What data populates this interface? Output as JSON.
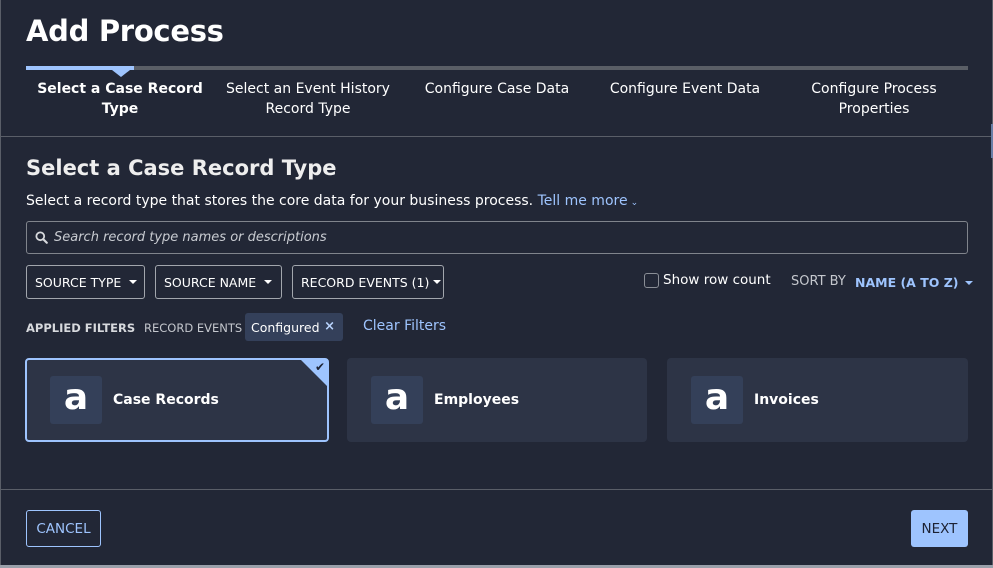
{
  "dialog": {
    "title": "Add Process"
  },
  "stepper": {
    "steps": [
      {
        "label": "Select a Case Record Type",
        "active": true
      },
      {
        "label": "Select an Event History Record Type",
        "active": false
      },
      {
        "label": "Configure Case Data",
        "active": false
      },
      {
        "label": "Configure Event Data",
        "active": false
      },
      {
        "label": "Configure Process Properties",
        "active": false
      }
    ]
  },
  "section": {
    "title": "Select a Case Record Type",
    "description": "Select a record type that stores the core data for your business process.",
    "tell_me_more": "Tell me more"
  },
  "search": {
    "placeholder": "Search record type names or descriptions",
    "value": ""
  },
  "filters": {
    "source_type": "SOURCE TYPE",
    "source_name": "SOURCE NAME",
    "record_events": "RECORD EVENTS (1)",
    "show_row_count": "Show row count",
    "show_row_count_checked": false,
    "sort_by_label": "SORT BY",
    "sort_by_value": "NAME (A TO Z)"
  },
  "applied_filters": {
    "label": "APPLIED FILTERS",
    "group": "RECORD EVENTS",
    "chip": "Configured",
    "remove_icon": "×",
    "clear": "Clear Filters"
  },
  "records": [
    {
      "name": "Case Records",
      "icon": "a",
      "selected": true
    },
    {
      "name": "Employees",
      "icon": "a",
      "selected": false
    },
    {
      "name": "Invoices",
      "icon": "a",
      "selected": false
    }
  ],
  "footer": {
    "cancel": "CANCEL",
    "next": "NEXT"
  },
  "colors": {
    "background": "#222736",
    "accent": "#9ec4fe",
    "card": "#2d3446",
    "chip": "#34405a"
  }
}
